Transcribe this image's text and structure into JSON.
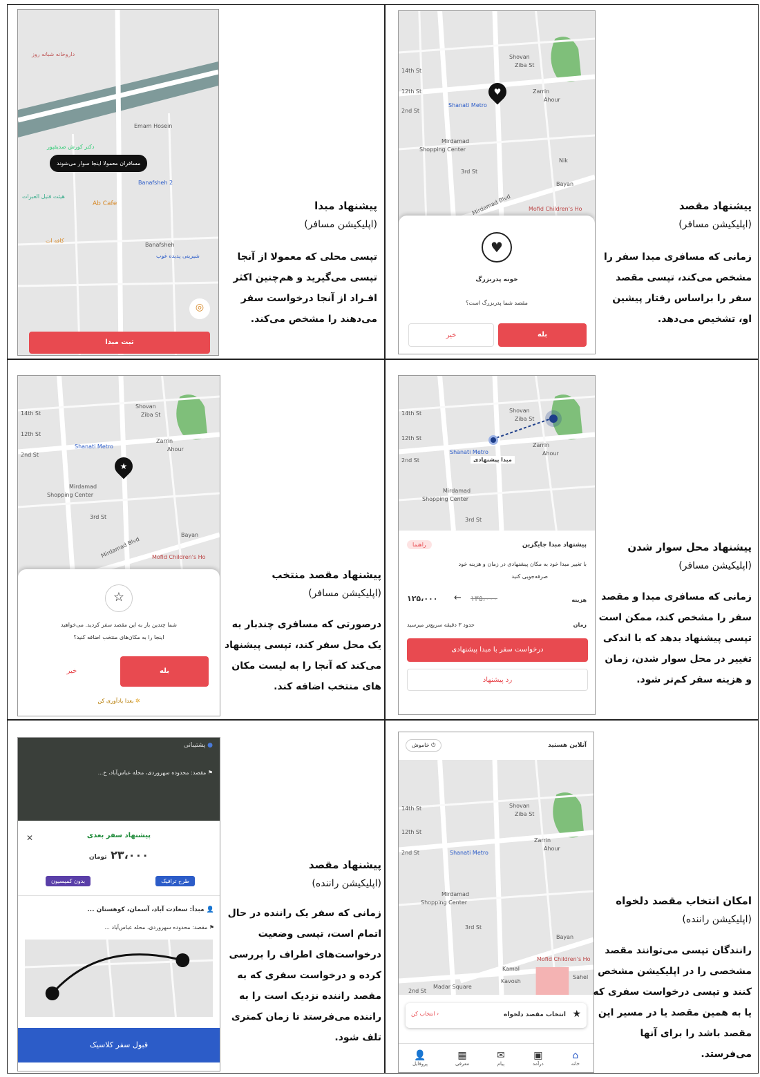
{
  "cells": {
    "c1": {
      "title": "پیشنهاد مقصد",
      "subtitle": "(اپلیکیشن مسافر)",
      "body": [
        "زمانی که مسافری مبدا سفر را",
        "مشخص می‌کند، تپسی مقصد",
        "سفر را براساس رفتار پیشین",
        "او، تشخیص می‌دهد."
      ],
      "phone": {
        "sheet_title": "خونه پدربزرگ",
        "sheet_question": "مقصد شما پدربزرگ است؟",
        "yes": "بله",
        "no": "خیر",
        "map_labels": [
          "Shovan",
          "Ziba St",
          "Zarrin",
          "Ahour",
          "Shanati Metro",
          "Mirdamad Shopping Center",
          "Mofid Children's Ho",
          "Bayan",
          "Nik",
          "Mirdamad Blvd",
          "14th St",
          "12th St",
          "2nd St",
          "3rd St"
        ]
      }
    },
    "c2": {
      "title": "پیشنهاد مبدا",
      "subtitle": "(اپلیکیشن مسافر)",
      "body": [
        "تپسی محلی که معمولا از آنجا",
        "تپسی می‌گیرید و هم‌چنین اکثر",
        "افـراد از آنجا درخواست سفر",
        "می‌دهند را مشخص می‌کند."
      ],
      "phone": {
        "tooltip": "مسافران معمولا اینجا سوار می‌شوند",
        "confirm": "ثبت مبدا",
        "map_labels": [
          "Ab Cafe",
          "Emam Hosein",
          "Banafsheh 2",
          "دکتر کورش صدیقپور",
          "هیئت قتیل العبرات",
          "داروخانه شبانه روز",
          "کافه ات",
          "شیرینی پدیده غوب",
          "Banafsheh"
        ]
      }
    },
    "c3": {
      "title": "پیشنهاد محل سوار شدن",
      "subtitle": "(اپلیکیشن مسافر)",
      "body": [
        "زمانی که مسافری مبدا و مقصد",
        "سفر را مشخص کند، ممکن است",
        "تپسی پیشنهاد بدهد که با اندکی",
        "تغییر در محل سوار شدن، زمان",
        "و هزینه سفر کم‌تر شود."
      ],
      "phone": {
        "pin_label": "مبدا پیشنهادی",
        "sheet_title": "پیشنهاد مبدا جایگزین",
        "guide": "راهنما",
        "desc": [
          "با تغییر مبدا خود به مکان پیشنهادی در زمان و هزینه خود",
          "صرفه‌جویی کنید"
        ],
        "cost_label": "هزینه",
        "cost_new": "۱۲۵،۰۰۰",
        "cost_old": "۱۳۵،۰۰۰",
        "time_label": "زمان",
        "time_value": "حدود ۳ دقیقه سریع‌تر میرسید",
        "request": "درخواست سفر با مبدا پیشنهادی",
        "reject": "رد پیشنهاد"
      }
    },
    "c4": {
      "title": "پیشنهاد مقصد منتخب",
      "subtitle": "(اپلیکیشن مسافر)",
      "body": [
        "درصورتی که مسافری چندبار به",
        "یک محل سفر کند، تپسی پیشنهاد",
        "می‌کند که آنجا را به لیست مکان",
        "های منتخب اضافه کند."
      ],
      "phone": {
        "question": [
          "شما چندین بار به این مقصد سفر کردید. می‌خواهید",
          "اینجا را به مکان‌های منتخب اضافه کنید؟"
        ],
        "yes": "بله",
        "no": "خیر",
        "later": "بعدا یادآوری کن"
      }
    },
    "c5": {
      "title": "امکان انتخاب مقصد دلخواه",
      "subtitle": "(اپلیکیشن راننده)",
      "body": [
        "رانندگان تپسی می‌توانند مقصد",
        "مشخصی را در اپلیکیشن مشخص",
        "کنند و تپسی درخواست سفری که",
        "یا به همین مقصد یا در مسیر این",
        "مقصد باشد را برای آنها می‌فرستد."
      ],
      "phone": {
        "status": "آنلاین هستید",
        "off": "خاموش",
        "select_title": "انتخاب مقصد دلخواه",
        "select_btn": "انتخاب کن",
        "nav": [
          "خانه",
          "درآمد",
          "پیام",
          "معرفی",
          "پروفایل"
        ],
        "map_labels": [
          "Madar Square",
          "Kavosh",
          "Kamal",
          "Sahel",
          "2nd St"
        ]
      }
    },
    "c6": {
      "title": "پیشنهاد مقصد",
      "subtitle": "(اپلیکیشن راننده)",
      "body": [
        "زمانی که سفر یک راننده در حال",
        "اتمام است، تپسی وضعیت",
        "درخواست‌های اطراف را بررسی",
        "کرده و درخواست سفری که به",
        "مقصد راننده نزدیک است را به",
        "راننده می‌فرستد تا زمان کمتری",
        "تلف شود."
      ],
      "phone": {
        "support": "پشتیبانی",
        "top_dest": "مقصد: محدوده سهروردی، محله عباس‌آباد، خ...",
        "next_trip": "پیشنهاد سفر بعدی",
        "price": "۲۳،۰۰۰",
        "currency": "تومان",
        "tag_traffic": "طرح ترافیک",
        "tag_commission": "بدون کمیسیون",
        "origin": "مبدأ: سعادت آباد، آسمان، کوهستان ...",
        "destination": "مقصد: محدوده سهروردی، محله عباس‌آباد ...",
        "accept": "قبول سفر کلاسیک"
      }
    }
  }
}
